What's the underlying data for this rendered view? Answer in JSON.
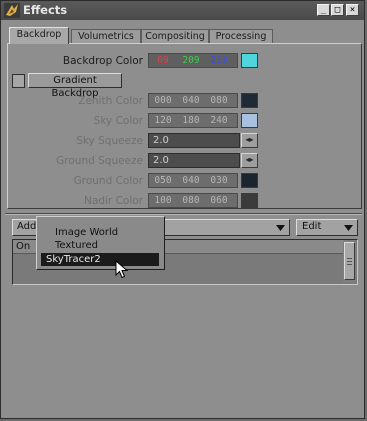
{
  "window": {
    "title": "Effects",
    "controls": {
      "minimize": "_",
      "maximize": "□",
      "close": "×"
    }
  },
  "tabs": [
    {
      "label": "Backdrop",
      "active": true
    },
    {
      "label": "Volumetrics",
      "active": false
    },
    {
      "label": "Compositing",
      "active": false
    },
    {
      "label": "Processing",
      "active": false
    }
  ],
  "backdrop": {
    "backdrop_color": {
      "label": "Backdrop Color",
      "r": "09",
      "g": "209",
      "b": "219",
      "swatch": "#4fd6dc"
    },
    "gradient_button": "Gradient Backdrop",
    "zenith_color": {
      "label": "Zenith Color",
      "r": "000",
      "g": "040",
      "b": "080",
      "swatch": "#1e2a36"
    },
    "sky_color": {
      "label": "Sky Color",
      "r": "120",
      "g": "180",
      "b": "240",
      "swatch": "#a7c2e0"
    },
    "sky_squeeze": {
      "label": "Sky Squeeze",
      "value": "2.0"
    },
    "ground_squeeze": {
      "label": "Ground Squeeze",
      "value": "2.0"
    },
    "ground_color": {
      "label": "Ground Color",
      "r": "050",
      "g": "040",
      "b": "030",
      "swatch": "#1a2530"
    },
    "nadir_color": {
      "label": "Nadir Color",
      "r": "100",
      "g": "080",
      "b": "060",
      "swatch": "#3b3b3b"
    }
  },
  "colors": {
    "r_text": "#e0414a",
    "g_text": "#3fcf4f",
    "b_text": "#3b4fe0"
  },
  "add_dropdown": {
    "value": "Add"
  },
  "edit_dropdown": {
    "value": "Edit"
  },
  "list": {
    "header": "On"
  },
  "popup_menu": {
    "items": [
      "Image World",
      "Textured Environment",
      "SkyTracer2"
    ],
    "highlighted": "SkyTracer2"
  }
}
